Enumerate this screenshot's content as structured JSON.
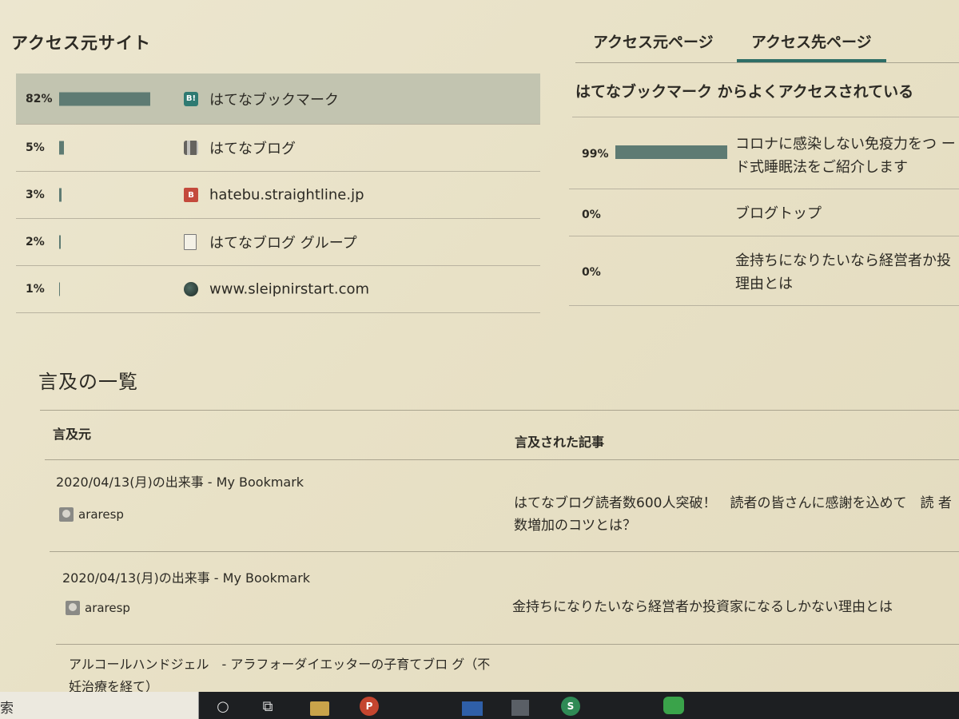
{
  "access_sources": {
    "title": "アクセス元サイト",
    "items": [
      {
        "percent": "82%",
        "fraction": 0.82,
        "label": "はてなブックマーク",
        "icon": "hatena-bookmark-icon",
        "selected": true
      },
      {
        "percent": "5%",
        "fraction": 0.05,
        "label": "はてなブログ",
        "icon": "hatena-blog-icon"
      },
      {
        "percent": "3%",
        "fraction": 0.03,
        "label": "hatebu.straightline.jp",
        "icon": "b-icon"
      },
      {
        "percent": "2%",
        "fraction": 0.02,
        "label": "はてなブログ グループ",
        "icon": "document-icon"
      },
      {
        "percent": "1%",
        "fraction": 0.01,
        "label": "www.sleipnirstart.com",
        "icon": "globe-icon"
      }
    ]
  },
  "tabs": [
    {
      "label": "アクセス元ページ",
      "active": false
    },
    {
      "label": "アクセス先ページ",
      "active": true
    }
  ],
  "access_destinations": {
    "header": "はてなブックマーク からよくアクセスされている",
    "items": [
      {
        "percent": "99%",
        "fraction": 0.99,
        "title": "コロナに感染しない免疫力をつ ード式睡眠法をご紹介します"
      },
      {
        "percent": "0%",
        "fraction": 0,
        "title": "ブログトップ"
      },
      {
        "percent": "0%",
        "fraction": 0,
        "title": "金持ちになりたいなら経営者か投 理由とは"
      }
    ]
  },
  "mentions": {
    "title": "言及の一覧",
    "col_source": "言及元",
    "col_article": "言及された記事",
    "rows": [
      {
        "source": "2020/04/13(月)の出来事 - My Bookmark",
        "user": "araresp",
        "article": "はてなブログ読者数600人突破！　読者の皆さんに感謝を込めて　読 者数増加のコツとは？"
      },
      {
        "source": "2020/04/13(月)の出来事 - My Bookmark",
        "user": "araresp",
        "article": "金持ちになりたいなら経営者か投資家になるしかない理由とは"
      },
      {
        "source": "アルコールハンドジェル　- アラフォーダイエッターの子育てブロ グ（不妊治療を経て）",
        "user": "",
        "article": ""
      }
    ]
  },
  "taskbar": {
    "search_text": "索",
    "icons": [
      "cortana-icon",
      "task-view-icon",
      "file-explorer-icon",
      "powerpoint-icon",
      "mail-icon",
      "store-icon",
      "app-green-icon",
      "line-icon"
    ]
  },
  "colors": {
    "bar": "#5e7b73",
    "accent": "#2e6e66",
    "background": "#e9e2c9"
  }
}
